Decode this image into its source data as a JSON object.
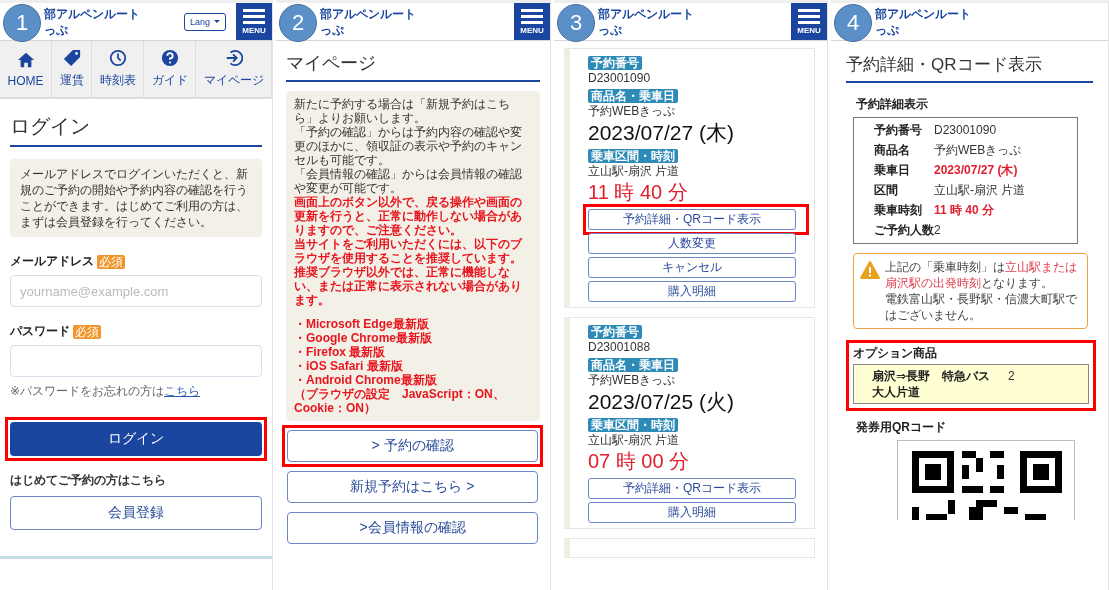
{
  "panels": [
    {
      "kind": "login",
      "step": "1",
      "header": {
        "brand_line_1": "部アルペンルート",
        "brand_line_2": "っぷ",
        "lang_button": "Lang",
        "menu_label": "MENU"
      },
      "nav": [
        {
          "label": "HOME"
        },
        {
          "label": "運賃"
        },
        {
          "label": "時刻表"
        },
        {
          "label": "ガイド"
        },
        {
          "label": "マイページ"
        }
      ],
      "heading": "ログイン",
      "notice": "メールアドレスでログインいただくと、新規のご予約の開始や予約内容の確認を行うことができます。はじめてご利用の方は、まずは会員登録を行ってください。",
      "fields": [
        {
          "label": "メールアドレス",
          "required_badge": "必須",
          "placeholder": "yourname@example.com"
        },
        {
          "label": "パスワード",
          "required_badge": "必須"
        }
      ],
      "forgot": {
        "text": "※パスワードをお忘れの方は",
        "link": "こちら"
      },
      "login_button": {
        "label": "ログイン",
        "highlighted": true
      },
      "register_prompt": "はじめてご予約の方はこちら",
      "register_button": {
        "label": "会員登録",
        "highlighted": false
      }
    },
    {
      "kind": "mypage",
      "step": "2",
      "header": {
        "brand_line_1": "部アルペンルート",
        "brand_line_2": "っぷ",
        "menu_label": "MENU"
      },
      "heading": "マイページ",
      "notice": [
        {
          "kind": "text",
          "text": "新たに予約する場合は「新規予約はこちら」よりお願いします。"
        },
        {
          "kind": "text",
          "text": "「予約の確認」からは予約内容の確認や変更のほかに、領収証の表示や予約のキャンセルも可能です。"
        },
        {
          "kind": "text",
          "text": "「会員情報の確認」からは会員情報の確認や変更が可能です。"
        },
        {
          "kind": "warning",
          "text": "画面上のボタン以外で、戻る操作や画面の更新を行うと、正常に動作しない場合がありますので、ご注意ください。"
        },
        {
          "kind": "warning",
          "text": "当サイトをご利用いただくには、以下のブラウザを使用することを推奨しています。"
        },
        {
          "kind": "warning",
          "text": "推奨ブラウザ以外では、正常に機能しない、または正常に表示されない場合があります。"
        },
        {
          "kind": "list_item",
          "text": "・Microsoft Edge最新版"
        },
        {
          "kind": "list_item",
          "text": "・Google Chrome最新版"
        },
        {
          "kind": "list_item",
          "text": "・Firefox 最新版"
        },
        {
          "kind": "list_item",
          "text": "・iOS Safari 最新版"
        },
        {
          "kind": "list_item",
          "text": "・Android Chrome最新版"
        },
        {
          "kind": "list_item",
          "text": "（ブラウザの設定　JavaScript：ON、Cookie：ON）"
        }
      ],
      "buttons": [
        {
          "label": "> 予約の確認",
          "highlighted": true
        },
        {
          "label": "新規予約はこちら >",
          "highlighted": false
        },
        {
          "label": ">会員情報の確認",
          "highlighted": false
        }
      ]
    },
    {
      "kind": "reservations",
      "step": "3",
      "header": {
        "brand_line_1": "部アルペンルート",
        "brand_line_2": "っぷ",
        "menu_label": "MENU"
      },
      "cards": [
        {
          "number_label": "予約番号",
          "number": "D23001090",
          "product_label": "商品名・乗車日",
          "product": "予約WEBきっぷ",
          "date": "2023/07/27 (木)",
          "route_label": "乗車区間・時刻",
          "route": "立山駅-扇沢 片道",
          "time": "11 時 40 分",
          "buttons": [
            {
              "label": "予約詳細・QRコード表示",
              "highlighted": true
            },
            {
              "label": "人数変更",
              "highlighted": false
            },
            {
              "label": "キャンセル",
              "highlighted": false
            },
            {
              "label": "購入明細",
              "highlighted": false
            }
          ]
        },
        {
          "number_label": "予約番号",
          "number": "D23001088",
          "product_label": "商品名・乗車日",
          "product": "予約WEBきっぷ",
          "date": "2023/07/25 (火)",
          "route_label": "乗車区間・時刻",
          "route": "立山駅-扇沢 片道",
          "time": "07 時 00 分",
          "buttons": [
            {
              "label": "予約詳細・QRコード表示",
              "highlighted": false
            },
            {
              "label": "購入明細",
              "highlighted": false
            }
          ]
        }
      ]
    },
    {
      "kind": "detail",
      "step": "4",
      "header": {
        "brand_line_1": "部アルペンルート",
        "brand_line_2": "っぷ"
      },
      "heading": "予約詳細・QRコード表示",
      "section_title": "予約詳細表示",
      "details": [
        {
          "label": "予約番号",
          "value": "D23001090",
          "emphasis": false
        },
        {
          "label": "商品名",
          "value": "予約WEBきっぷ",
          "emphasis": false
        },
        {
          "label": "乗車日",
          "value": "2023/07/27 (木)",
          "emphasis": true
        },
        {
          "label": "区間",
          "value": "立山駅-扇沢 片道",
          "emphasis": false
        },
        {
          "label": "乗車時刻",
          "value": "11 時 40 分",
          "emphasis": true
        },
        {
          "label": "ご予約人数",
          "value": "2",
          "emphasis": false
        }
      ],
      "notice": [
        {
          "parts": [
            {
              "text": "上記の「乗車時刻」は",
              "emphasis": false
            },
            {
              "text": "立山駅または扇沢駅の出発時刻",
              "emphasis": true
            },
            {
              "text": "となります。",
              "emphasis": false
            }
          ]
        },
        {
          "parts": [
            {
              "text": "電鉄富山駅・長野駅・信濃大町駅ではございません。",
              "emphasis": false
            }
          ]
        }
      ],
      "option_title": "オプション商品",
      "option": {
        "name": "扇沢⇒長野　特急バス大人片道",
        "quantity": "2",
        "highlighted": true
      },
      "qr_title": "発券用QRコード"
    }
  ]
}
